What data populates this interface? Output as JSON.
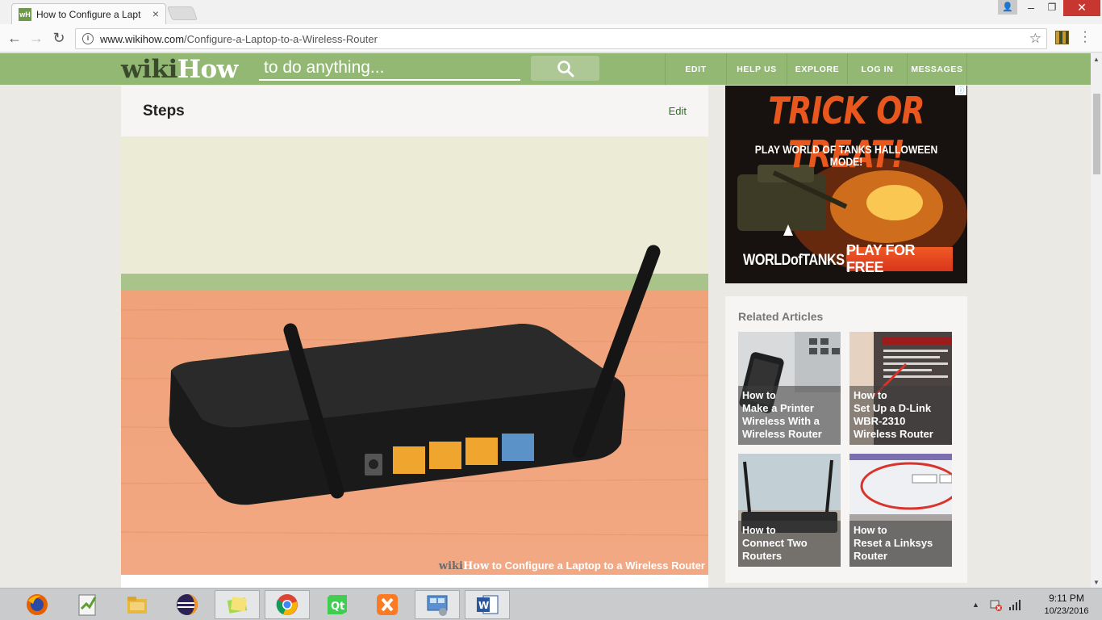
{
  "browser": {
    "tab_title": "How to Configure a Lapt",
    "favicon_text": "wH",
    "url_host": "www.wikihow.com",
    "url_path": "/Configure-a-Laptop-to-a-Wireless-Router"
  },
  "header": {
    "logo_wiki": "wiki",
    "logo_how": "How",
    "search_placeholder": "to do anything...",
    "nav": [
      "EDIT",
      "HELP US",
      "EXPLORE",
      "LOG IN",
      "MESSAGES"
    ]
  },
  "content": {
    "section_title": "Steps",
    "edit_link": "Edit",
    "image_watermark_wiki": "wiki",
    "image_watermark_how": "How",
    "image_watermark_text": " to Configure a Laptop to a Wireless Router"
  },
  "ad": {
    "headline": "TRICK OR TREAT!",
    "subline": "PLAY WORLD OF TANKS HALLOWEEN MODE!",
    "brand": "WORLDofTANKS",
    "cta": "PLAY FOR FREE"
  },
  "related": {
    "title": "Related Articles",
    "items": [
      {
        "howto": "How to",
        "title": "Make a Printer Wireless With a Wireless Router"
      },
      {
        "howto": "How to",
        "title": "Set Up a D-Link WBR-2310 Wireless Router"
      },
      {
        "howto": "How to",
        "title": "Connect Two Routers"
      },
      {
        "howto": "How to",
        "title": "Reset a Linksys Router"
      }
    ]
  },
  "taskbar": {
    "apps": [
      "firefox-icon",
      "notepad-plus-icon",
      "file-explorer-icon",
      "eclipse-icon",
      "folder-icon",
      "chrome-icon",
      "qt-creator-icon",
      "xampp-icon",
      "control-panel-icon",
      "word-icon"
    ],
    "time": "9:11 PM",
    "date": "10/23/2016"
  },
  "colors": {
    "wikihow_green": "#93b874",
    "wikihow_dark": "#3a4a2c",
    "ad_orange": "#e8571d"
  }
}
